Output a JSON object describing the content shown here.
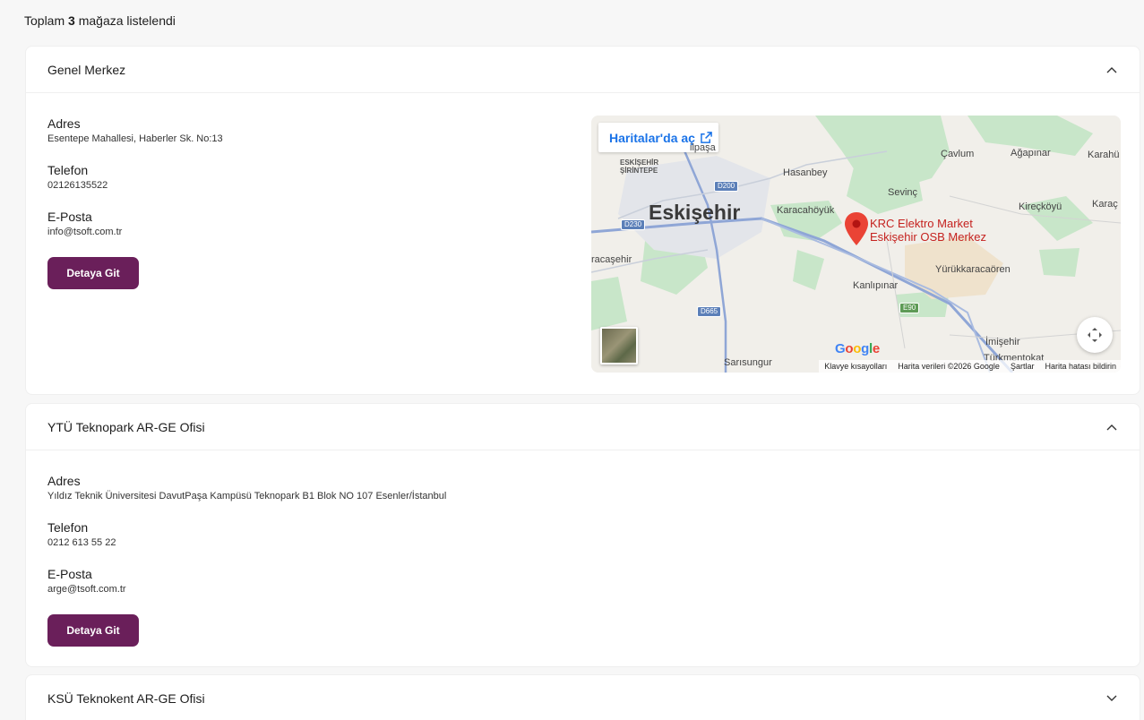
{
  "summary": {
    "prefix": "Toplam",
    "count": "3",
    "suffix": "mağaza listelendi"
  },
  "stores": [
    {
      "title": "Genel Merkez",
      "expanded": true,
      "address_label": "Adres",
      "address": "Esentepe Mahallesi, Haberler Sk. No:13",
      "phone_label": "Telefon",
      "phone": "02126135522",
      "email_label": "E-Posta",
      "email": "info@tsoft.com.tr",
      "button": "Detaya Git"
    },
    {
      "title": "YTÜ Teknopark AR-GE Ofisi",
      "expanded": true,
      "address_label": "Adres",
      "address": "Yıldız Teknik Üniversitesi DavutPaşa Kampüsü Teknopark B1 Blok NO 107 Esenler/İstanbul",
      "phone_label": "Telefon",
      "phone": "0212 613 55 22",
      "email_label": "E-Posta",
      "email": "arge@tsoft.com.tr",
      "button": "Detaya Git"
    },
    {
      "title": "KSÜ Teknokent AR-GE Ofisi",
      "expanded": false
    }
  ],
  "map": {
    "open_label": "Haritalar'da aç",
    "city": "Eskişehir",
    "marker_label_line1": "KRC Elektro Market",
    "marker_label_line2": "Eskişehir OSB Merkez",
    "places": {
      "cumhuriye": "ilpaşa",
      "eskisehir_sirintepe_1": "ESKİŞEHİR",
      "eskisehir_sirintepe_2": "ŞİRİNTEPE",
      "hasanbey": "Hasanbey",
      "cavlum": "Çavlum",
      "agapinar": "Ağapınar",
      "karahuyuk": "Karahü",
      "sevinc": "Sevinç",
      "karacahoyuk": "Karacahöyük",
      "kireckoyu": "Kireçköyü",
      "karac": "Karaç",
      "karacasehir": "racaşehir",
      "yurukkaracaoren": "Yürükkaracaören",
      "kanlipinar": "Kanlıpınar",
      "imisehir": "İmişehir",
      "turkmentokat": "Türkmentokat",
      "sarisungur": "Sarısungur"
    },
    "roads": {
      "d200": "D200",
      "d230": "D230",
      "d665": "D665",
      "e90": "E90"
    },
    "brand": "Google",
    "attribution": {
      "shortcuts": "Klavye kısayolları",
      "data": "Harita verileri ©2026 Google",
      "terms": "Şartlar",
      "report": "Harita hatası bildirin"
    },
    "colors": {
      "marker": "#ea4335",
      "label": "#c5221f",
      "link": "#1a73e8",
      "road": "#8fa6d6"
    }
  },
  "colors": {
    "button_bg": "#6a1f5a",
    "page_bg": "#f7f7f7"
  }
}
